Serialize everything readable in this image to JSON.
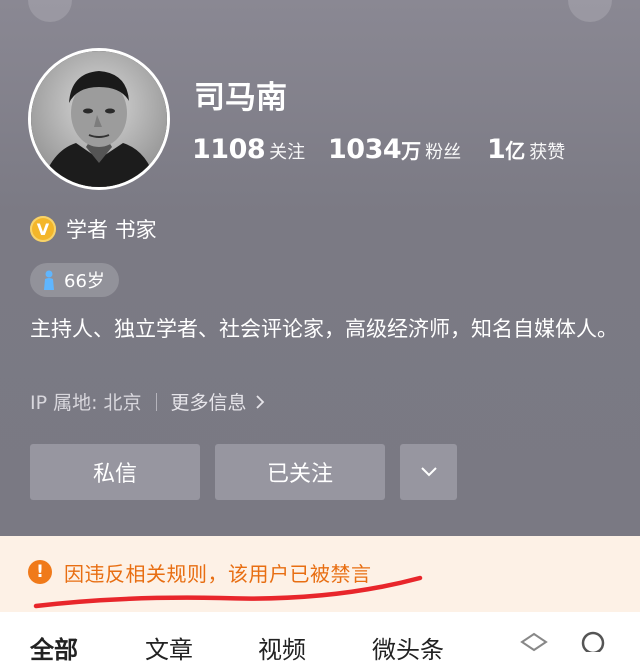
{
  "profile": {
    "name": "司马南",
    "stats": [
      {
        "num": "1108",
        "unit": "",
        "label": "关注"
      },
      {
        "num": "1034",
        "unit": "万",
        "label": "粉丝"
      },
      {
        "num": "1",
        "unit": "亿",
        "label": "获赞"
      }
    ],
    "verification": {
      "badge": "V",
      "text": "学者 书家"
    },
    "age_tag": "66岁",
    "bio": "主持人、独立学者、社会评论家，高级经济师，知名自媒体人。",
    "ip_location": "IP 属地: 北京",
    "more_info": "更多信息"
  },
  "actions": {
    "message_label": "私信",
    "followed_label": "已关注"
  },
  "notice": {
    "icon": "!",
    "text": "因违反相关规则，该用户已被禁言",
    "color": "#e86e12"
  },
  "tabs": [
    "全部",
    "文章",
    "视频",
    "微头条"
  ],
  "colors": {
    "header_bg": "#7b7a84",
    "button_bg": "#9796a0",
    "notice_bg": "#fdf1e6",
    "annotation_red": "#e8262b"
  }
}
